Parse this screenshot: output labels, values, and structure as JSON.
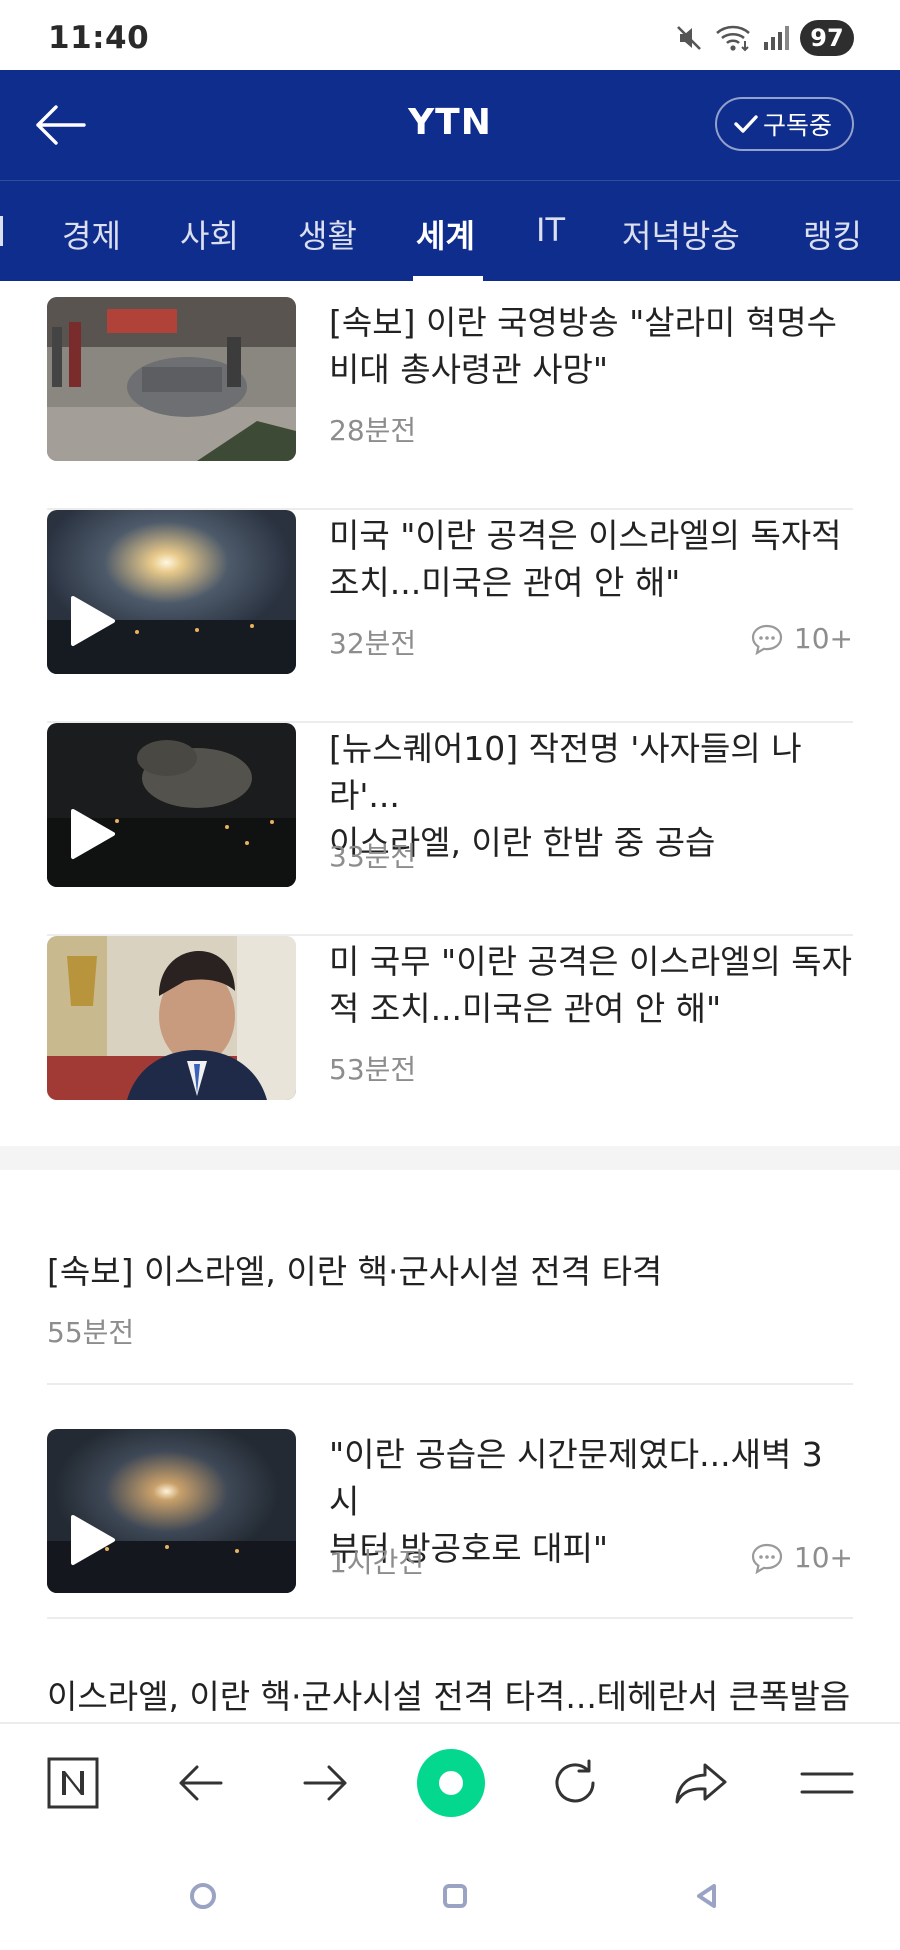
{
  "status_bar": {
    "time": "11:40",
    "battery": "97"
  },
  "header": {
    "back_icon": "arrow-left-icon",
    "title": "YTN",
    "subscribe_label": "구독중",
    "subscribe_icon": "check-icon",
    "bg_color": "#0e2d8c"
  },
  "tabs": [
    {
      "label": "경제",
      "active": false
    },
    {
      "label": "사회",
      "active": false
    },
    {
      "label": "생활",
      "active": false
    },
    {
      "label": "세계",
      "active": true
    },
    {
      "label": "IT",
      "active": false
    },
    {
      "label": "저녁방송",
      "active": false
    },
    {
      "label": "랭킹",
      "active": false
    }
  ],
  "articles": [
    {
      "title": "[속보] 이란 국영방송 \"살라미 혁명수\n비대 총사령관 사망\"",
      "time": "28분전",
      "video": false,
      "comments": ""
    },
    {
      "title": "미국 \"이란 공격은 이스라엘의 독자적\n조치...미국은 관여 안 해\"",
      "time": "32분전",
      "video": true,
      "comments": "10+"
    },
    {
      "title": "[뉴스퀘어10] 작전명 '사자들의 나라'...\n이스라엘, 이란 한밤 중 공습",
      "time": "33분전",
      "video": true,
      "comments": ""
    },
    {
      "title": "미 국무 \"이란 공격은 이스라엘의 독자\n적 조치...미국은 관여 안 해\"",
      "time": "53분전",
      "video": false,
      "comments": ""
    }
  ],
  "text_article": {
    "title": "[속보] 이스라엘, 이란 핵·군사시설 전격 타격",
    "time": "55분전"
  },
  "article_5": {
    "title": "\"이란 공습은 시간문제였다...새벽 3시\n부터 방공호로 대피\"",
    "time": "1시간전",
    "video": true,
    "comments": "10+"
  },
  "partial_article": {
    "title": "이스라엘, 이란 핵·군사시설 전격 타격...테헤란서 큰폭발음"
  },
  "browser_bar": {
    "buttons": [
      "naver-home-icon",
      "back-arrow-icon",
      "forward-arrow-icon",
      "green-dot-icon",
      "refresh-icon",
      "share-icon",
      "menu-icon"
    ],
    "accent": "#03d88e"
  },
  "system_nav": [
    "recents-icon",
    "home-icon",
    "back-icon"
  ]
}
